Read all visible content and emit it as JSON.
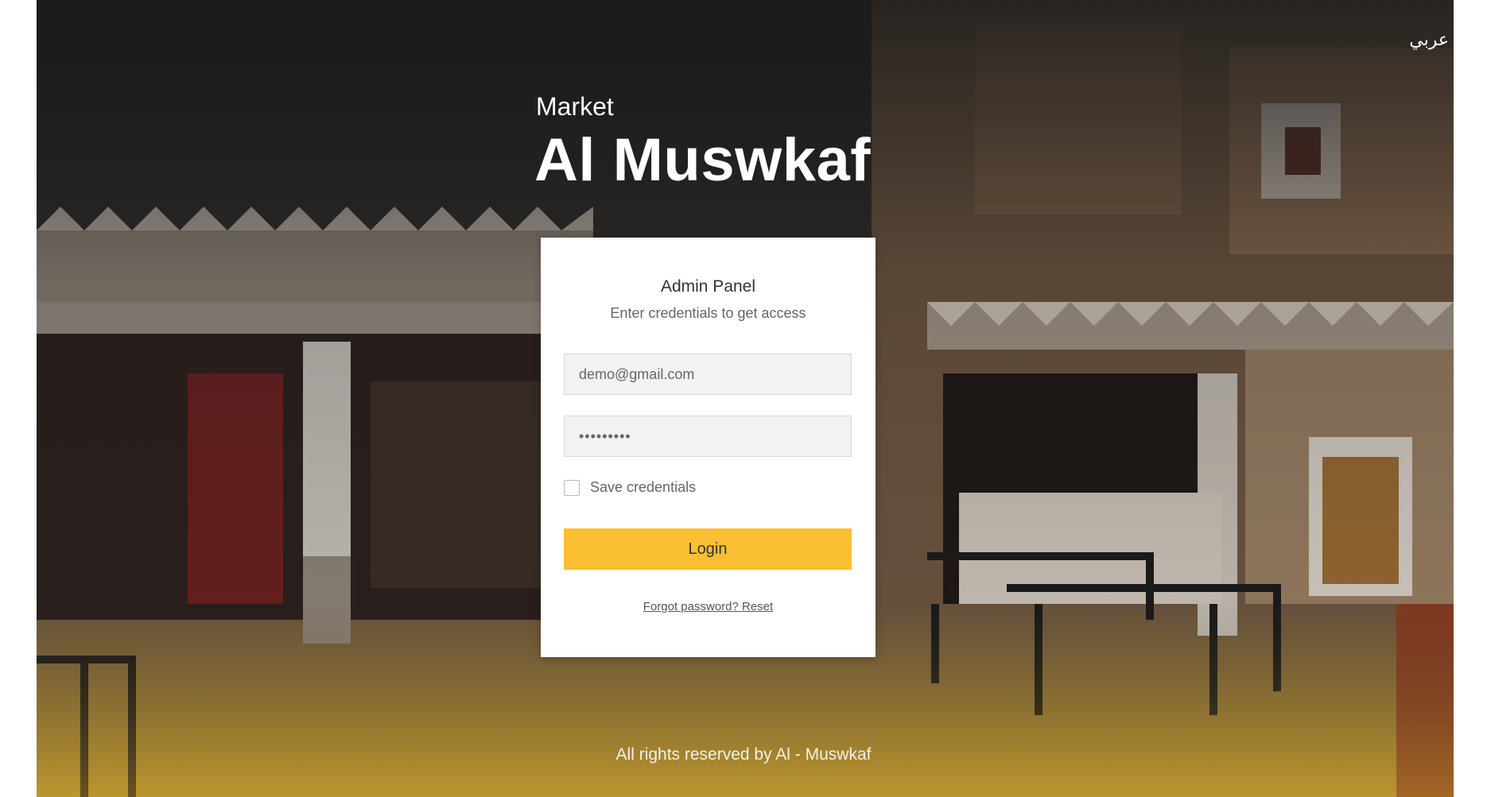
{
  "header": {
    "language_toggle": "عربي"
  },
  "brand": {
    "subtitle": "Market",
    "title": "Al Muswkaf"
  },
  "login_card": {
    "title": "Admin Panel",
    "subtitle": "Enter credentials to get access",
    "email": {
      "value": "demo@gmail.com"
    },
    "password": {
      "value": "•••••••••"
    },
    "remember_label": "Save credentials",
    "remember_checked": false,
    "login_label": "Login",
    "forgot_label": "Forgot password? Reset"
  },
  "footer": {
    "copyright": "All rights reserved by Al - Muswkaf"
  },
  "colors": {
    "accent": "#fbbf33",
    "card_bg": "#ffffff",
    "field_bg": "#f2f2f2"
  },
  "icons": {
    "checkbox": "checkbox-unchecked-icon"
  }
}
